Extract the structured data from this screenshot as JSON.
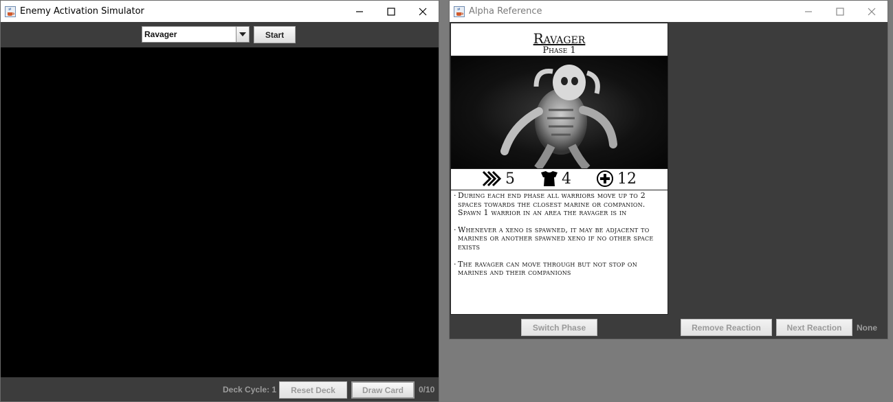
{
  "simulator": {
    "title": "Enemy Activation Simulator",
    "enemy_select": {
      "value": "Ravager"
    },
    "start_label": "Start",
    "footer": {
      "deck_cycle_label": "Deck Cycle: 1",
      "reset_deck_label": "Reset Deck",
      "draw_card_label": "Draw Card",
      "count": "0/10"
    }
  },
  "reference": {
    "title": "Alpha Reference",
    "card": {
      "name": "Ravager",
      "phase": "Phase 1",
      "stats": {
        "move": "5",
        "armor": "4",
        "health": "12"
      },
      "abilities": [
        "During each end phase all warriors move up to 2 spaces towards the closest marine or companion. Spawn 1 warrior in an area the ravager is in",
        "Whenever a xeno is spawned, it may be adjacent to marines or another spawned xeno if no other space exists",
        "The ravager can move through but not stop on marines and their companions"
      ]
    },
    "switch_phase_label": "Switch Phase",
    "remove_reaction_label": "Remove Reaction",
    "next_reaction_label": "Next Reaction",
    "reaction_status": "None"
  },
  "colors": {
    "java_panel": "#3c3c3c",
    "canvas": "#000000",
    "desktop": "#7b7b7b",
    "card_bg": "#ffffff"
  },
  "icons": {
    "app": "java-coffee-icon",
    "move": "speed-chevrons-icon",
    "armor": "armor-vest-icon",
    "health": "health-cross-icon"
  }
}
